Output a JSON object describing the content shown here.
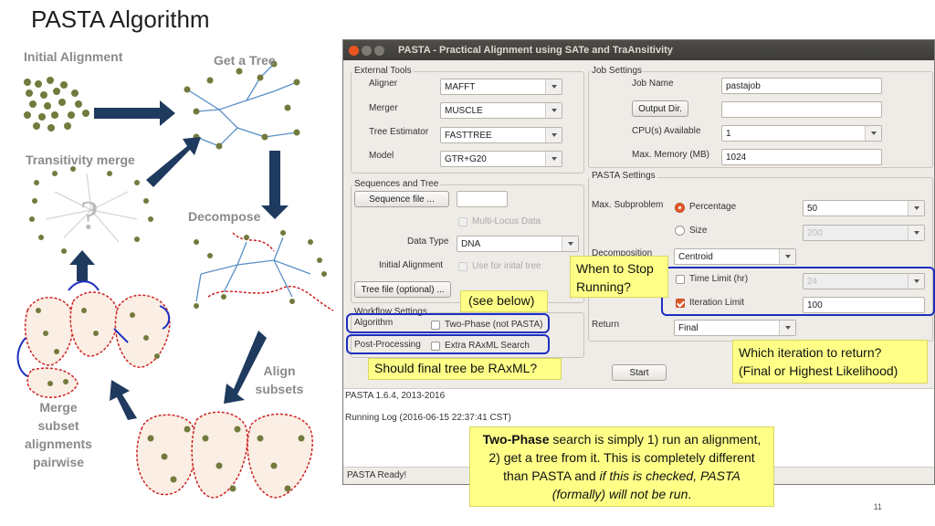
{
  "slide": {
    "title": "PASTA Algorithm",
    "page_number": "11",
    "diagram_labels": {
      "initial_alignment": "Initial Alignment",
      "get_tree": "Get a Tree",
      "transitivity_merge": "Transitivity merge",
      "decompose": "Decompose",
      "align_subsets": "Align\nsubsets",
      "merge_pairwise": "Merge\nsubset\nalignments\npairwise",
      "question_mark": "?"
    }
  },
  "window": {
    "title": "PASTA - Practical Alignment using SATe and TraAnsitivity",
    "external_tools": {
      "title": "External Tools",
      "aligner_label": "Aligner",
      "aligner_value": "MAFFT",
      "merger_label": "Merger",
      "merger_value": "MUSCLE",
      "tree_label": "Tree Estimator",
      "tree_value": "FASTTREE",
      "model_label": "Model",
      "model_value": "GTR+G20"
    },
    "job_settings": {
      "title": "Job Settings",
      "job_name_label": "Job Name",
      "job_name_value": "pastajob",
      "output_dir_button": "Output Dir.",
      "cpus_label": "CPU(s) Available",
      "cpus_value": "1",
      "memory_label": "Max. Memory (MB)",
      "memory_value": "1024"
    },
    "sequences": {
      "title": "Sequences and Tree",
      "sequence_file_button": "Sequence file ...",
      "multilocus_label": "Multi-Locus Data",
      "data_type_label": "Data Type",
      "data_type_value": "DNA",
      "initial_alignment_label": "Initial Alignment",
      "use_initial_tree_label": "Use for inital tree",
      "tree_file_button": "Tree file (optional) ..."
    },
    "pasta_settings": {
      "title": "PASTA Settings",
      "max_subproblem_label": "Max. Subproblem",
      "percentage_label": "Percentage",
      "percentage_value": "50",
      "size_label": "Size",
      "size_value": "200",
      "decomposition_label": "Decomposition",
      "decomposition_value": "Centroid",
      "time_limit_label": "Time Limit (hr)",
      "time_limit_value": "24",
      "iteration_limit_label": "Iteration Limit",
      "iteration_limit_value": "100",
      "return_label": "Return",
      "return_value": "Final"
    },
    "workflow": {
      "title": "Workflow Settings",
      "algorithm_label": "Algorithm",
      "two_phase_label": "Two-Phase (not PASTA)",
      "post_processing_label": "Post-Processing",
      "extra_raxml_label": "Extra RAxML Search"
    },
    "start_button": "Start",
    "log": {
      "version": "PASTA 1.6.4, 2013-2016",
      "running_log": "Running Log (2016-06-15 22:37:41 CST)"
    },
    "status": "PASTA Ready!"
  },
  "callouts": {
    "see_below": "(see below)",
    "when_to_stop": "When to Stop\nRunning?",
    "final_tree": "Should final tree be RAxML?",
    "which_iteration": "Which iteration to return?\n(Final or Highest Likelihood)",
    "two_phase_bold": "Two-Phase",
    "two_phase_text": " search is simply 1) run an alignment, 2) get a tree from it. This is completely different than PASTA and ",
    "two_phase_italic": "if this is checked, PASTA (formally) will not be run",
    "two_phase_end": "."
  }
}
